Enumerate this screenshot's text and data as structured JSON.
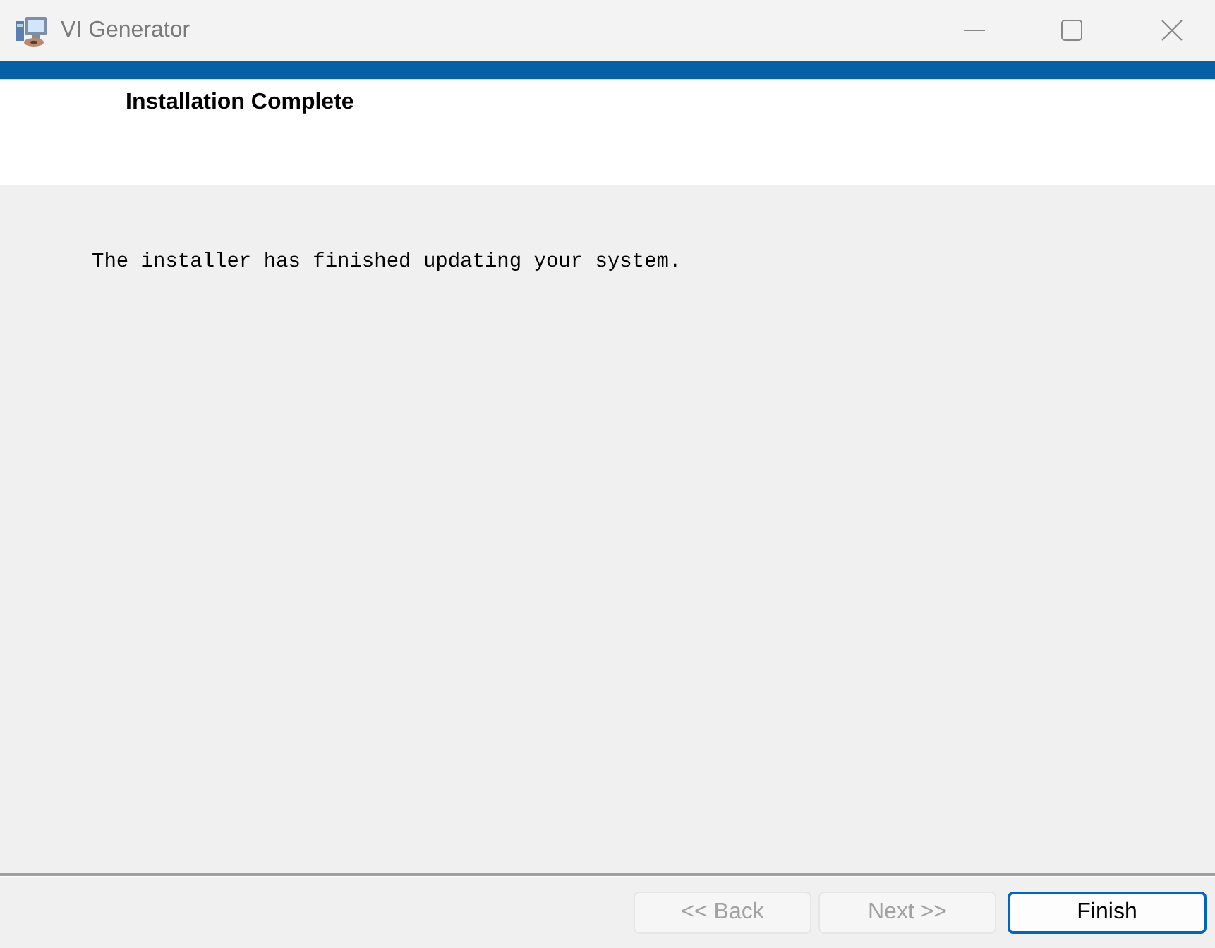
{
  "window": {
    "title": "VI Generator"
  },
  "header": {
    "title": "Installation Complete"
  },
  "body": {
    "message": "The installer has finished updating your system."
  },
  "buttons": [
    {
      "label": "<< Back",
      "disabled": true,
      "default": false
    },
    {
      "label": "Next >>",
      "disabled": true,
      "default": false
    },
    {
      "label": "Finish",
      "disabled": false,
      "default": true
    }
  ]
}
